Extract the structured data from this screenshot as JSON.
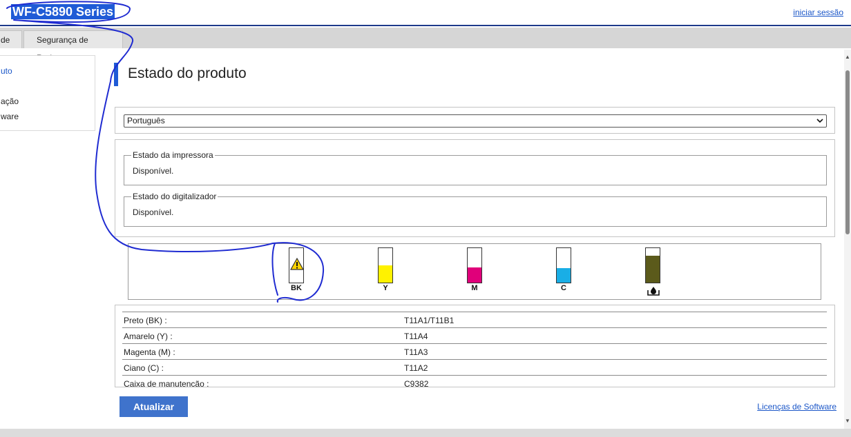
{
  "header": {
    "title": "WF-C5890 Series",
    "login_link": "iniciar sessão"
  },
  "tabs": [
    {
      "label": "de"
    },
    {
      "label": "Segurança de Rede"
    }
  ],
  "left_nav": {
    "items": [
      {
        "label": "uto",
        "active": true
      },
      {
        "label": "ação",
        "active": false
      },
      {
        "label": "ware",
        "active": false
      }
    ]
  },
  "main": {
    "title": "Estado do produto",
    "language_select": {
      "value": "Português"
    },
    "printer_status": {
      "legend": "Estado da impressora",
      "value": "Disponível."
    },
    "scanner_status": {
      "legend": "Estado do digitalizador",
      "value": "Disponível."
    }
  },
  "ink_levels": [
    {
      "label": "BK",
      "color": "#ffffff",
      "level": 0.0,
      "warning": true
    },
    {
      "label": "Y",
      "color": "#fff200",
      "level": 0.5,
      "warning": false
    },
    {
      "label": "M",
      "color": "#e0007a",
      "level": 0.45,
      "warning": false
    },
    {
      "label": "C",
      "color": "#19aee6",
      "level": 0.42,
      "warning": false
    },
    {
      "label": "",
      "color": "#5b5a1b",
      "level": 0.78,
      "warning": false,
      "icon": "maintenance-box-icon"
    }
  ],
  "cartridges": [
    {
      "name": "Preto (BK) :",
      "code": "T11A1/T11B1"
    },
    {
      "name": "Amarelo (Y) :",
      "code": "T11A4"
    },
    {
      "name": "Magenta (M) :",
      "code": "T11A3"
    },
    {
      "name": "Ciano (C) :",
      "code": "T11A2"
    },
    {
      "name": "Caixa de manutenção :",
      "code": "C9382"
    }
  ],
  "footer": {
    "refresh_button": "Atualizar",
    "licenses_link": "Licenças de Software"
  },
  "colors": {
    "accent": "#1f5bd6",
    "link": "#1a56c8",
    "button": "#3f73cc",
    "annotation_pen": "#1f2bd1"
  }
}
